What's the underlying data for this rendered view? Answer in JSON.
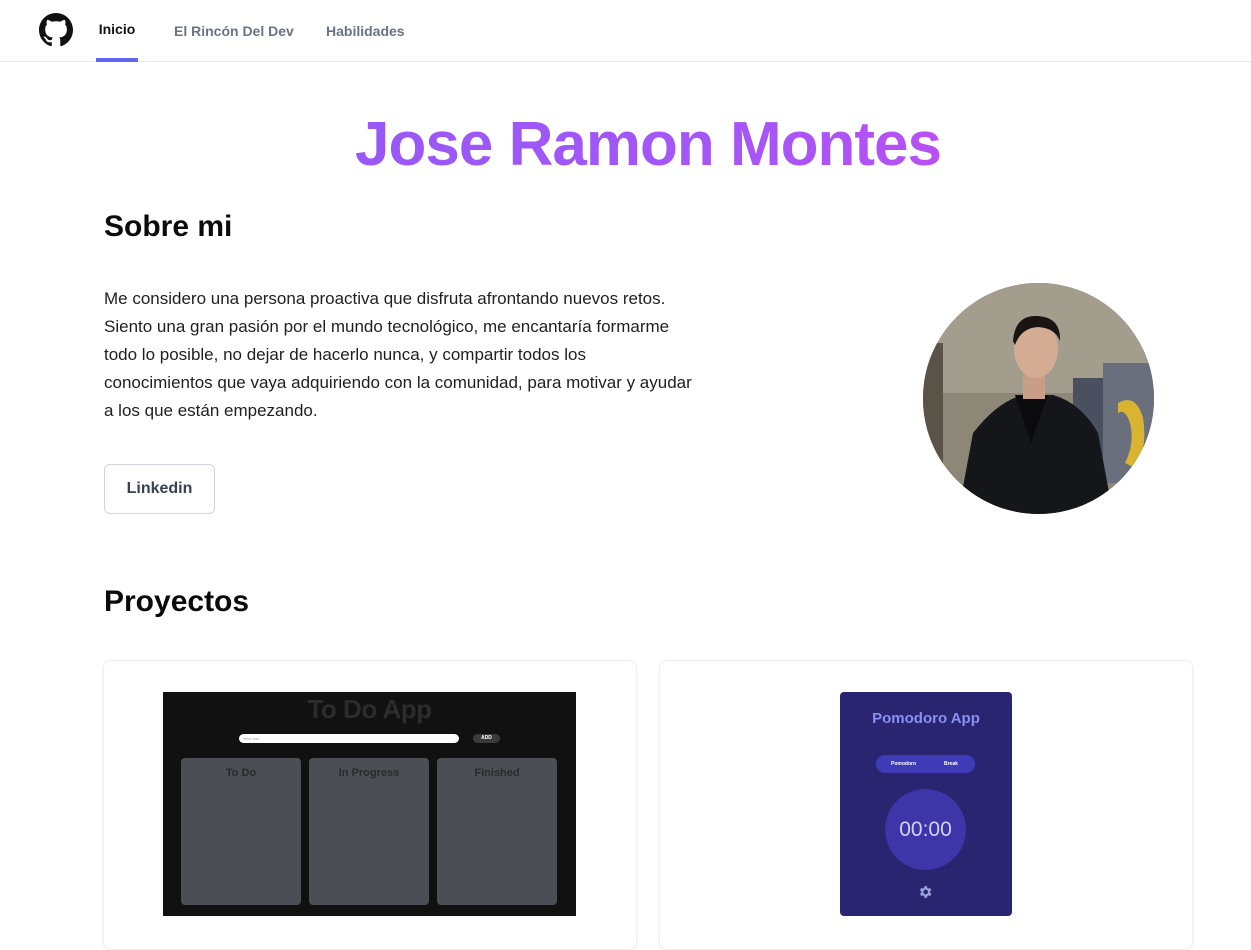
{
  "nav": {
    "tabs": [
      {
        "label": "Inicio",
        "active": true
      },
      {
        "label": "El Rincón Del Dev",
        "active": false
      },
      {
        "label": "Habilidades",
        "active": false
      }
    ],
    "accent": "#6366f1",
    "logo_icon": "github-icon"
  },
  "hero": {
    "title": "Jose Ramon Montes",
    "gradient": [
      "#8b5cf6",
      "#d946ef"
    ]
  },
  "about": {
    "title": "Sobre mi",
    "text": "Me considero una persona proactiva que disfruta afrontando nuevos retos. Siento una gran pasión por el mundo tecnológico, me encantaría formarme todo lo posible, no dejar de hacerlo nunca, y compartir todos los conocimientos que vaya adquiriendo con la comunidad, para motivar y ayudar a los que están empezando.",
    "button_label": "Linkedin"
  },
  "projects": {
    "title": "Proyectos",
    "items": [
      {
        "name": "To Do App",
        "input_placeholder": "New task",
        "add_label": "ADD",
        "columns": [
          "To Do",
          "In Progress",
          "Finished"
        ]
      },
      {
        "name": "Pomodoro App",
        "toggle": [
          "Pomodoro",
          "Break"
        ],
        "timer": "00:00",
        "settings_icon": "gear-icon"
      }
    ]
  }
}
